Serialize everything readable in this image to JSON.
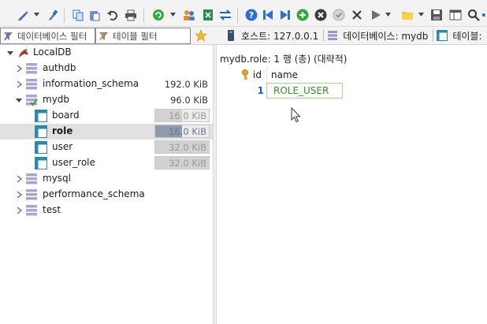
{
  "toolbar": {
    "icons": [
      "pen-icon",
      "dropdown-arrow",
      "brush-icon",
      "copy-icon",
      "paste-icon",
      "undo-icon",
      "print-icon",
      "refresh-icon",
      "dropdown-arrow",
      "users-icon",
      "excel-icon",
      "transfer-icon",
      "help-icon",
      "first-icon",
      "last-icon",
      "add-icon",
      "delete-icon",
      "check-icon",
      "cancel-icon",
      "run-icon",
      "dropdown-arrow",
      "folder-icon",
      "dropdown-arrow",
      "save-icon",
      "layout-icon",
      "search-icon"
    ]
  },
  "filters": {
    "database_placeholder": "데이터베이스 필터",
    "table_placeholder": "테이블 필터"
  },
  "tabs": [
    {
      "label": "호스트: 127.0.0.1",
      "icon": "host-icon"
    },
    {
      "label": "데이터베이스: mydb",
      "icon": "database-icon"
    },
    {
      "label": "테이블: ",
      "icon": "table-icon"
    }
  ],
  "tree": {
    "root": "LocalDB",
    "items": [
      {
        "label": "authdb",
        "type": "database",
        "size": "",
        "expanded": false
      },
      {
        "label": "information_schema",
        "type": "database",
        "size": "192.0 KiB",
        "expanded": false
      },
      {
        "label": "mydb",
        "type": "database",
        "size": "96.0 KiB",
        "expanded": true
      },
      {
        "label": "board",
        "type": "table",
        "size": "16.0 KiB",
        "fill": 0.5
      },
      {
        "label": "role",
        "type": "table",
        "size": "16.0 KiB",
        "fill": 0.5,
        "selected": true
      },
      {
        "label": "user",
        "type": "table",
        "size": "32.0 KiB",
        "fill": 1.0
      },
      {
        "label": "user_role",
        "type": "table",
        "size": "32.0 KiB",
        "fill": 1.0
      },
      {
        "label": "mysql",
        "type": "database",
        "size": "",
        "expanded": false
      },
      {
        "label": "performance_schema",
        "type": "database",
        "size": "",
        "expanded": false
      },
      {
        "label": "test",
        "type": "database",
        "size": "",
        "expanded": false
      }
    ]
  },
  "result": {
    "status": "mydb.role: 1 행 (총) (대략적)",
    "columns": [
      "id",
      "name"
    ],
    "rows": [
      {
        "id": "1",
        "name": "ROLE_USER"
      }
    ]
  },
  "colors": {
    "selected_row": "#e1e1e1",
    "row_number": "#1b5fbf",
    "name_text": "#3a8a2a",
    "name_border": "#a8d0a0",
    "key_icon": "#e0a020"
  }
}
